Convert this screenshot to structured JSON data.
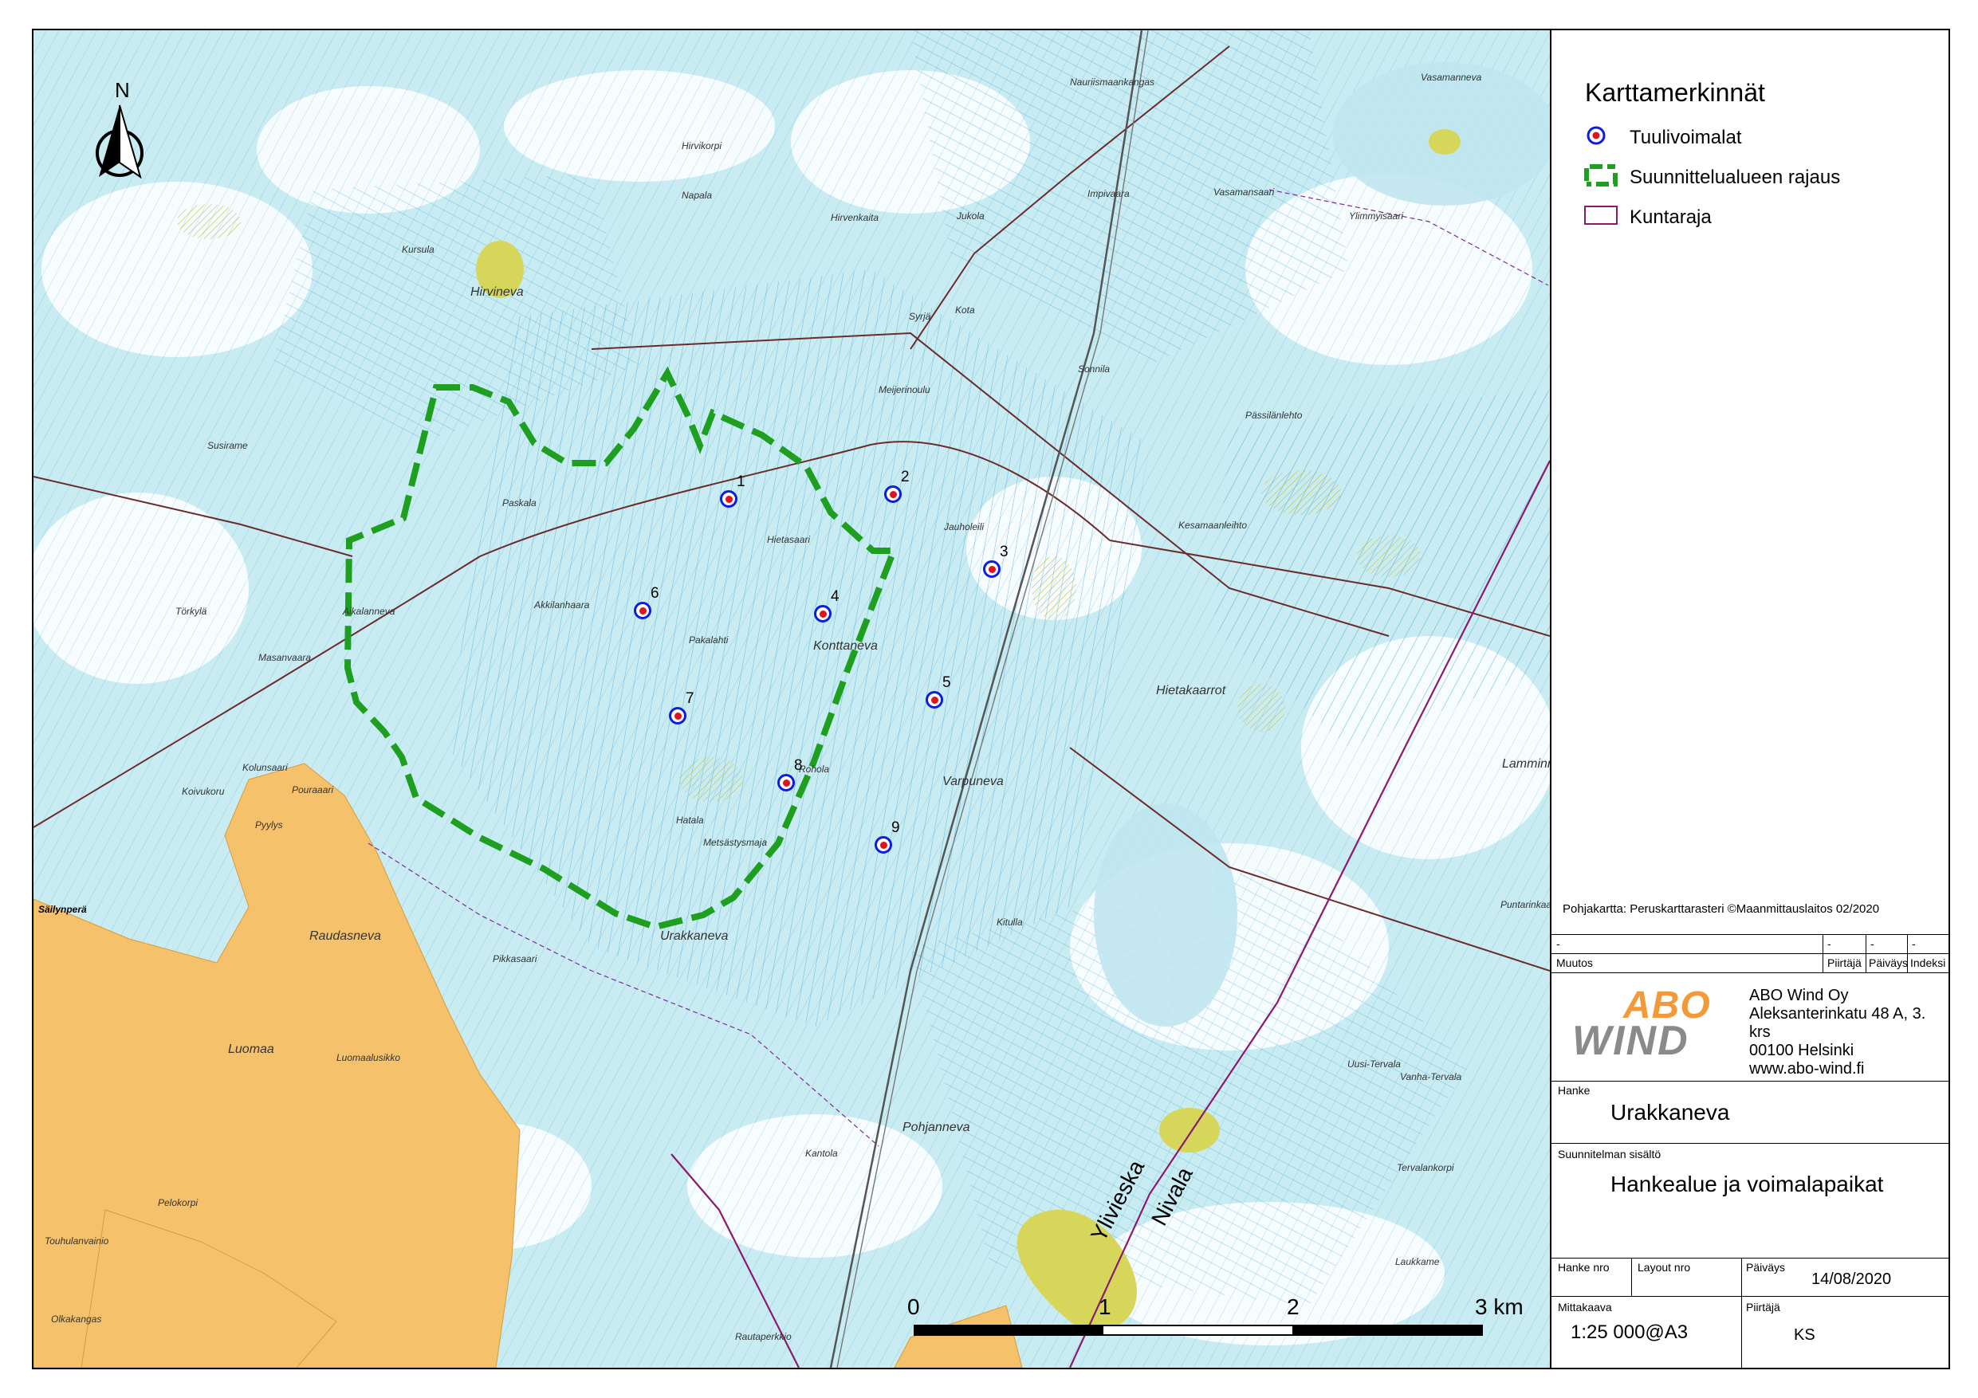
{
  "map": {
    "north_label": "N",
    "place_names": [
      {
        "text": "Nauriismaankangas"
      },
      {
        "text": "Hirvikorpi"
      },
      {
        "text": "Napala"
      },
      {
        "text": "Hirvineva"
      },
      {
        "text": "Kursula"
      },
      {
        "text": "Susirame"
      },
      {
        "text": "Paskala"
      },
      {
        "text": "Törkylä"
      },
      {
        "text": "Aikalanneva"
      },
      {
        "text": "Masanvaara"
      },
      {
        "text": "Pakalahti"
      },
      {
        "text": "Konttaneva"
      },
      {
        "text": "Hietasaari"
      },
      {
        "text": "Jauholeili"
      },
      {
        "text": "Kesamaanleihto"
      },
      {
        "text": "Hietakaarrot"
      },
      {
        "text": "Varpuneva"
      },
      {
        "text": "Rohola"
      },
      {
        "text": "Hatala"
      },
      {
        "text": "Metsästysmaja"
      },
      {
        "text": "Urakkaneva"
      },
      {
        "text": "Raudasneva"
      },
      {
        "text": "Säilynperä"
      },
      {
        "text": "Pohjanneva"
      },
      {
        "text": "Luomaalusikko"
      },
      {
        "text": "Touhulanvainio"
      },
      {
        "text": "Kantola"
      },
      {
        "text": "Lamminneva"
      },
      {
        "text": "Puntarinkaarto"
      },
      {
        "text": "Uusi-Tervala"
      },
      {
        "text": "Vanha-Tervala"
      },
      {
        "text": "Tervalankorpi"
      },
      {
        "text": "Vasamanneva"
      },
      {
        "text": "Ylimmyisaari"
      },
      {
        "text": "Pässilänlehto"
      },
      {
        "text": "Sonnila"
      },
      {
        "text": "Meijerinoulu"
      },
      {
        "text": "Syrjä"
      },
      {
        "text": "Kota"
      },
      {
        "text": "Luomaa"
      },
      {
        "text": "Pikkasaari"
      },
      {
        "text": "Koivukoru"
      },
      {
        "text": "Kolunsaari"
      },
      {
        "text": "Akkilanhaara"
      },
      {
        "text": "Kitulla"
      },
      {
        "text": "Rautaperkkio"
      },
      {
        "text": "Olkakangas"
      },
      {
        "text": "Pelokorpi"
      },
      {
        "text": "Hirvenkaita"
      },
      {
        "text": "Jukola"
      },
      {
        "text": "Impivaara"
      },
      {
        "text": "Vasamansaari"
      },
      {
        "text": "Pyylys"
      },
      {
        "text": "Pouraaari"
      },
      {
        "text": "Laukkame"
      }
    ],
    "turbines": [
      {
        "id": "1"
      },
      {
        "id": "2"
      },
      {
        "id": "3"
      },
      {
        "id": "4"
      },
      {
        "id": "5"
      },
      {
        "id": "6"
      },
      {
        "id": "7"
      },
      {
        "id": "8"
      },
      {
        "id": "9"
      }
    ],
    "municipality_labels": [
      "Ylivieska",
      "Nivala"
    ],
    "scalebar": {
      "ticks": [
        "0",
        "1",
        "2",
        "3 km"
      ]
    },
    "colors": {
      "water": "#bfe6f0",
      "ditch": "#3a9fcf",
      "field": "#f5c26b",
      "marsh": "#d6d75a",
      "boundary": "#1f9f1f",
      "muni": "#8b1a6e",
      "road": "#6b2b2b"
    }
  },
  "legend": {
    "title": "Karttamerkinnät",
    "items": [
      {
        "label": "Tuulivoimalat",
        "symbol": "turbine-icon"
      },
      {
        "label": "Suunnittelualueen rajaus",
        "symbol": "dashed-boundary-icon"
      },
      {
        "label": "Kuntaraja",
        "symbol": "municipal-border-icon"
      }
    ]
  },
  "credit": "Pohjakartta: Peruskarttarasteri ©Maanmittauslaitos 02/2020",
  "revision_table": {
    "row": [
      "-",
      "-",
      "-",
      "-"
    ],
    "headers": [
      "Muutos",
      "Piirtäjä",
      "Päiväys",
      "Indeksi"
    ]
  },
  "company": {
    "logo_top": "ABO",
    "logo_bottom": "WIND",
    "lines": [
      "ABO Wind Oy",
      "Aleksanterinkatu 48 A, 3. krs",
      "00100 Helsinki",
      "www.abo-wind.fi"
    ]
  },
  "title_block": {
    "hanke_label": "Hanke",
    "hanke_value": "Urakkaneva",
    "content_label": "Suunnitelman sisältö",
    "content_value": "Hankealue ja voimalapaikat",
    "hanke_nro_label": "Hanke nro",
    "layout_nro_label": "Layout nro",
    "date_label": "Päiväys",
    "date_value": "14/08/2020",
    "scale_label": "Mittakaava",
    "scale_value": "1:25 000@A3",
    "drawer_label": "Piirtäjä",
    "drawer_value": "KS"
  }
}
